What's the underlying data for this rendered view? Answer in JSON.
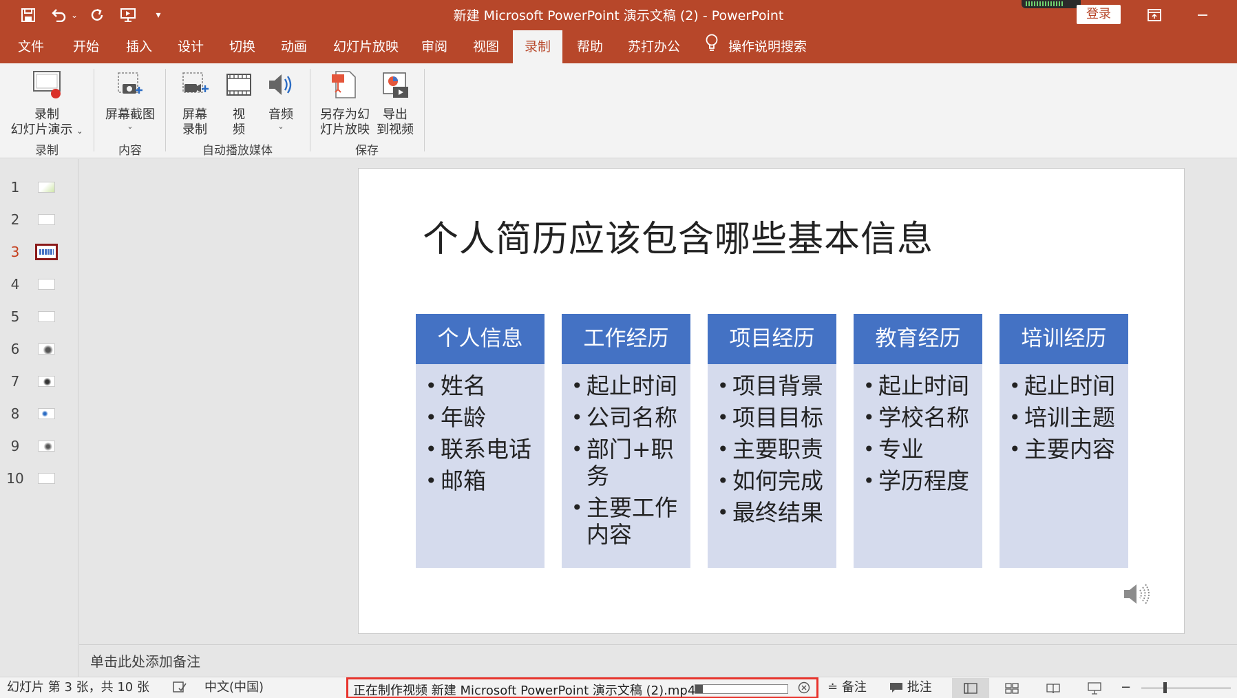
{
  "window": {
    "title": "新建 Microsoft PowerPoint 演示文稿 (2)  -  PowerPoint",
    "login": "登录",
    "accent_color": "#b7472a"
  },
  "quick_access": [
    "save-icon",
    "undo-icon",
    "redo-icon",
    "present-icon",
    "customize-icon"
  ],
  "tabs": [
    {
      "label": "文件"
    },
    {
      "label": "开始"
    },
    {
      "label": "插入"
    },
    {
      "label": "设计"
    },
    {
      "label": "切换"
    },
    {
      "label": "动画"
    },
    {
      "label": "幻灯片放映"
    },
    {
      "label": "审阅"
    },
    {
      "label": "视图"
    },
    {
      "label": "录制",
      "active": true
    },
    {
      "label": "帮助"
    },
    {
      "label": "苏打办公"
    }
  ],
  "tell_me": "操作说明搜索",
  "ribbon": {
    "record_slideshow": {
      "line1": "录制",
      "line2": "幻灯片演示"
    },
    "screenshot": "屏幕截图",
    "screen_record": {
      "line1": "屏幕",
      "line2": "录制"
    },
    "video": {
      "line1": "视",
      "line2": "频"
    },
    "audio": "音频",
    "save_as_show": {
      "line1": "另存为幻",
      "line2": "灯片放映"
    },
    "export_video": {
      "line1": "导出",
      "line2": "到视频"
    },
    "groups": [
      "录制",
      "内容",
      "自动播放媒体",
      "保存"
    ]
  },
  "thumbnails": {
    "current": "3",
    "items": [
      "1",
      "2",
      "3",
      "4",
      "5",
      "6",
      "7",
      "8",
      "9",
      "10"
    ]
  },
  "slide": {
    "title": "个人简历应该包含哪些基本信息",
    "columns": [
      {
        "header": "个人信息",
        "items": [
          "姓名",
          "年龄",
          "联系电话",
          "邮箱"
        ]
      },
      {
        "header": "工作经历",
        "items": [
          "起止时间",
          "公司名称",
          "部门+职务",
          "主要工作内容"
        ]
      },
      {
        "header": "项目经历",
        "items": [
          "项目背景",
          "项目目标",
          "主要职责",
          "如何完成",
          "最终结果"
        ]
      },
      {
        "header": "教育经历",
        "items": [
          "起止时间",
          "学校名称",
          "专业",
          "学历程度"
        ]
      },
      {
        "header": "培训经历",
        "items": [
          "起止时间",
          "培训主题",
          "主要内容"
        ]
      }
    ],
    "header_color": "#4472c4",
    "body_color": "#d5dbed"
  },
  "notes_placeholder": "单击此处添加备注",
  "status": {
    "slide_info": "幻灯片 第 3 张，共 10 张",
    "language": "中文(中国)",
    "progress_text": "正在制作视频 新建 Microsoft PowerPoint 演示文稿 (2).mp4",
    "progress_fraction": 0.08,
    "notes": "备注",
    "comments": "批注"
  }
}
